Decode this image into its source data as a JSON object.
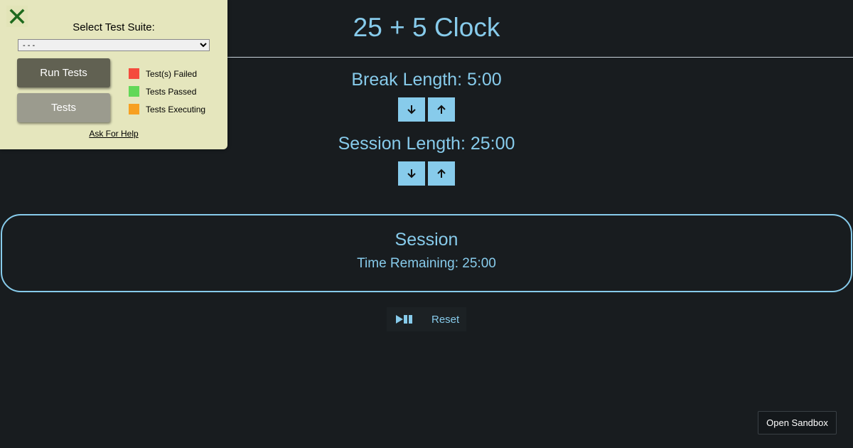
{
  "app": {
    "title": "25 + 5 Clock"
  },
  "break": {
    "label": "Break Length: 5:00",
    "decrement_icon": "arrow-down-icon",
    "increment_icon": "arrow-up-icon"
  },
  "session": {
    "label": "Session Length: 25:00",
    "decrement_icon": "arrow-down-icon",
    "increment_icon": "arrow-up-icon"
  },
  "timer": {
    "label": "Session",
    "time_remaining": "Time Remaining: 25:00"
  },
  "controls": {
    "play_pause_icon": "play-pause-icon",
    "reset_label": "Reset"
  },
  "sandbox": {
    "label": "Open Sandbox"
  },
  "test_panel": {
    "close_icon": "close-icon",
    "suite_label": "Select Test Suite:",
    "suite_selected": "- - -",
    "run_label": "Run Tests",
    "tests_label": "Tests",
    "legend": [
      {
        "label": "Test(s) Failed",
        "color": "#f44b3d"
      },
      {
        "label": "Tests Passed",
        "color": "#62d858"
      },
      {
        "label": "Tests Executing",
        "color": "#f7a021"
      }
    ],
    "help_label": "Ask For Help"
  },
  "colors": {
    "background": "#181c1f",
    "accent": "#87cbeb",
    "panel": "#e5e6bd"
  }
}
